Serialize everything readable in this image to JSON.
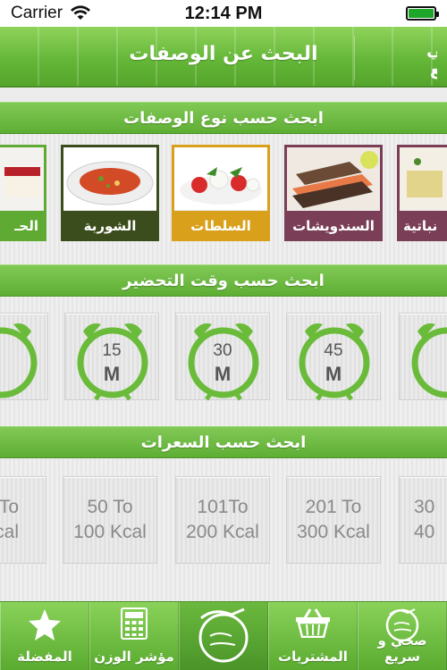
{
  "status": {
    "carrier": "Carrier",
    "time": "12:14 PM"
  },
  "nav": {
    "title": "البحث عن الوصفات",
    "logo_line1": "صحّي",
    "logo_line2": "وسريع"
  },
  "sections": {
    "type": "ابحث حسب نوع الوصفات",
    "time": "ابحث حسب وقت التحضير",
    "calories": "ابحث حسب السعرات"
  },
  "categories": [
    {
      "label": "الحـ",
      "color": "#5faa32"
    },
    {
      "label": "الشوربة",
      "color": "#3b4d1c"
    },
    {
      "label": "السلطات",
      "color": "#d9a01b"
    },
    {
      "label": "السندويشات",
      "color": "#7a3e57"
    },
    {
      "label": "نباتية",
      "color": "#7a3e57"
    }
  ],
  "time_tiles": [
    {
      "value": "15",
      "unit": "M"
    },
    {
      "value": "30",
      "unit": "M"
    },
    {
      "value": "45",
      "unit": "M"
    }
  ],
  "calorie_tiles": [
    {
      "line1": "50 To",
      "line2": "100 Kcal"
    },
    {
      "line1": "101To",
      "line2": "200 Kcal"
    },
    {
      "line1": "201 To",
      "line2": "300 Kcal"
    }
  ],
  "calorie_edges": {
    "left_line1": "To",
    "left_line2": "cal",
    "right_line1": "30",
    "right_line2": "40"
  },
  "tabs": [
    {
      "label": "المفضلة",
      "icon": "star-icon"
    },
    {
      "label": "مؤشر الوزن",
      "icon": "calculator-icon"
    },
    {
      "label": "",
      "icon": "logo-icon"
    },
    {
      "label": "المشتريات",
      "icon": "basket-icon"
    },
    {
      "label": "صحي و سريع",
      "icon": "logo-icon"
    }
  ],
  "colors": {
    "green": "#6abb3a",
    "dark_green": "#4b8f27",
    "clock_green": "#6abb3a",
    "tile_text": "#8a8a8a"
  }
}
